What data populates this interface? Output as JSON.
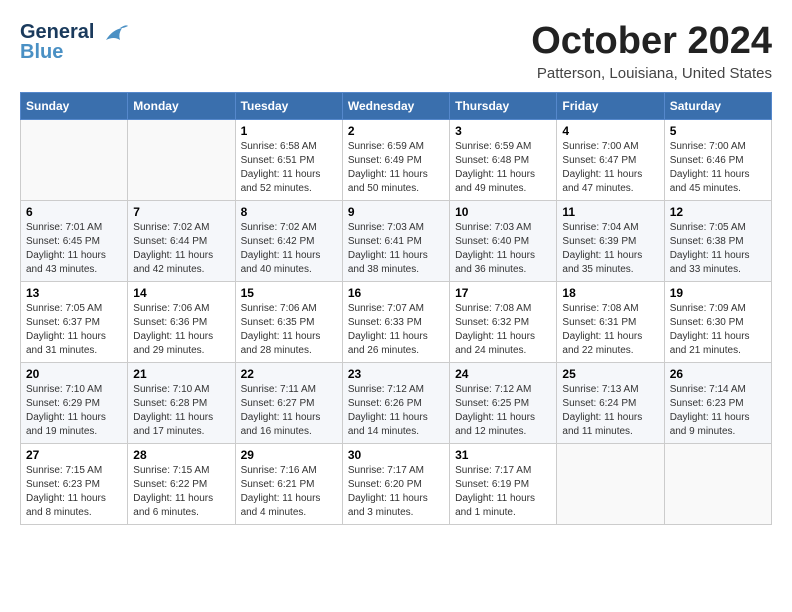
{
  "header": {
    "logo_line1": "General",
    "logo_line2": "Blue",
    "month_title": "October 2024",
    "location": "Patterson, Louisiana, United States"
  },
  "weekdays": [
    "Sunday",
    "Monday",
    "Tuesday",
    "Wednesday",
    "Thursday",
    "Friday",
    "Saturday"
  ],
  "weeks": [
    [
      {
        "day": "",
        "info": ""
      },
      {
        "day": "",
        "info": ""
      },
      {
        "day": "1",
        "info": "Sunrise: 6:58 AM\nSunset: 6:51 PM\nDaylight: 11 hours\nand 52 minutes."
      },
      {
        "day": "2",
        "info": "Sunrise: 6:59 AM\nSunset: 6:49 PM\nDaylight: 11 hours\nand 50 minutes."
      },
      {
        "day": "3",
        "info": "Sunrise: 6:59 AM\nSunset: 6:48 PM\nDaylight: 11 hours\nand 49 minutes."
      },
      {
        "day": "4",
        "info": "Sunrise: 7:00 AM\nSunset: 6:47 PM\nDaylight: 11 hours\nand 47 minutes."
      },
      {
        "day": "5",
        "info": "Sunrise: 7:00 AM\nSunset: 6:46 PM\nDaylight: 11 hours\nand 45 minutes."
      }
    ],
    [
      {
        "day": "6",
        "info": "Sunrise: 7:01 AM\nSunset: 6:45 PM\nDaylight: 11 hours\nand 43 minutes."
      },
      {
        "day": "7",
        "info": "Sunrise: 7:02 AM\nSunset: 6:44 PM\nDaylight: 11 hours\nand 42 minutes."
      },
      {
        "day": "8",
        "info": "Sunrise: 7:02 AM\nSunset: 6:42 PM\nDaylight: 11 hours\nand 40 minutes."
      },
      {
        "day": "9",
        "info": "Sunrise: 7:03 AM\nSunset: 6:41 PM\nDaylight: 11 hours\nand 38 minutes."
      },
      {
        "day": "10",
        "info": "Sunrise: 7:03 AM\nSunset: 6:40 PM\nDaylight: 11 hours\nand 36 minutes."
      },
      {
        "day": "11",
        "info": "Sunrise: 7:04 AM\nSunset: 6:39 PM\nDaylight: 11 hours\nand 35 minutes."
      },
      {
        "day": "12",
        "info": "Sunrise: 7:05 AM\nSunset: 6:38 PM\nDaylight: 11 hours\nand 33 minutes."
      }
    ],
    [
      {
        "day": "13",
        "info": "Sunrise: 7:05 AM\nSunset: 6:37 PM\nDaylight: 11 hours\nand 31 minutes."
      },
      {
        "day": "14",
        "info": "Sunrise: 7:06 AM\nSunset: 6:36 PM\nDaylight: 11 hours\nand 29 minutes."
      },
      {
        "day": "15",
        "info": "Sunrise: 7:06 AM\nSunset: 6:35 PM\nDaylight: 11 hours\nand 28 minutes."
      },
      {
        "day": "16",
        "info": "Sunrise: 7:07 AM\nSunset: 6:33 PM\nDaylight: 11 hours\nand 26 minutes."
      },
      {
        "day": "17",
        "info": "Sunrise: 7:08 AM\nSunset: 6:32 PM\nDaylight: 11 hours\nand 24 minutes."
      },
      {
        "day": "18",
        "info": "Sunrise: 7:08 AM\nSunset: 6:31 PM\nDaylight: 11 hours\nand 22 minutes."
      },
      {
        "day": "19",
        "info": "Sunrise: 7:09 AM\nSunset: 6:30 PM\nDaylight: 11 hours\nand 21 minutes."
      }
    ],
    [
      {
        "day": "20",
        "info": "Sunrise: 7:10 AM\nSunset: 6:29 PM\nDaylight: 11 hours\nand 19 minutes."
      },
      {
        "day": "21",
        "info": "Sunrise: 7:10 AM\nSunset: 6:28 PM\nDaylight: 11 hours\nand 17 minutes."
      },
      {
        "day": "22",
        "info": "Sunrise: 7:11 AM\nSunset: 6:27 PM\nDaylight: 11 hours\nand 16 minutes."
      },
      {
        "day": "23",
        "info": "Sunrise: 7:12 AM\nSunset: 6:26 PM\nDaylight: 11 hours\nand 14 minutes."
      },
      {
        "day": "24",
        "info": "Sunrise: 7:12 AM\nSunset: 6:25 PM\nDaylight: 11 hours\nand 12 minutes."
      },
      {
        "day": "25",
        "info": "Sunrise: 7:13 AM\nSunset: 6:24 PM\nDaylight: 11 hours\nand 11 minutes."
      },
      {
        "day": "26",
        "info": "Sunrise: 7:14 AM\nSunset: 6:23 PM\nDaylight: 11 hours\nand 9 minutes."
      }
    ],
    [
      {
        "day": "27",
        "info": "Sunrise: 7:15 AM\nSunset: 6:23 PM\nDaylight: 11 hours\nand 8 minutes."
      },
      {
        "day": "28",
        "info": "Sunrise: 7:15 AM\nSunset: 6:22 PM\nDaylight: 11 hours\nand 6 minutes."
      },
      {
        "day": "29",
        "info": "Sunrise: 7:16 AM\nSunset: 6:21 PM\nDaylight: 11 hours\nand 4 minutes."
      },
      {
        "day": "30",
        "info": "Sunrise: 7:17 AM\nSunset: 6:20 PM\nDaylight: 11 hours\nand 3 minutes."
      },
      {
        "day": "31",
        "info": "Sunrise: 7:17 AM\nSunset: 6:19 PM\nDaylight: 11 hours\nand 1 minute."
      },
      {
        "day": "",
        "info": ""
      },
      {
        "day": "",
        "info": ""
      }
    ]
  ]
}
